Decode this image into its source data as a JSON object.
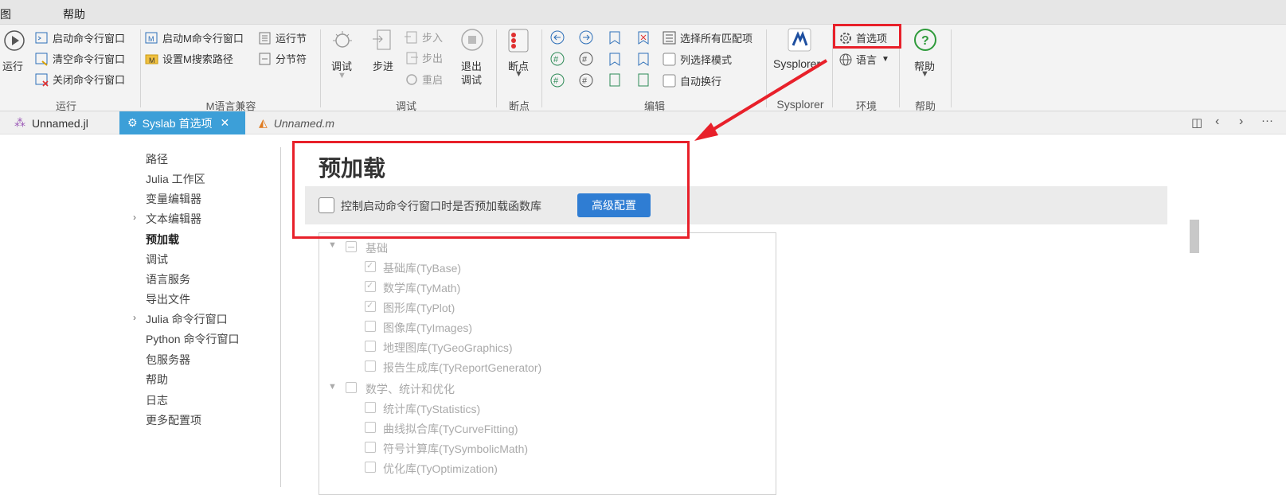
{
  "menu": {
    "left_fragment": "图",
    "help": "帮助"
  },
  "ribbon": {
    "run": {
      "label": "运行",
      "start_cmd": "启动命令行窗口",
      "clear_cmd": "清空命令行窗口",
      "close_cmd": "关闭命令行窗口",
      "group": "运行"
    },
    "mlang": {
      "start_m": "启动M命令行窗口",
      "set_m_path": "设置M搜索路径",
      "run_section": "运行节",
      "section_sep": "分节符",
      "group": "M语言兼容"
    },
    "debug": {
      "debug": "调试",
      "step": "步进",
      "step_in": "步入",
      "step_out": "步出",
      "restart": "重启",
      "exit_debug_1": "退出",
      "exit_debug_2": "调试",
      "group": "调试"
    },
    "breakpoint": {
      "label": "断点",
      "group": "断点"
    },
    "edit": {
      "select_all_matches": "选择所有匹配项",
      "column_select": "列选择模式",
      "word_wrap": "自动换行",
      "group": "编辑"
    },
    "sysplorer": {
      "label": "Sysplorer",
      "group": "Sysplorer"
    },
    "env": {
      "preferences": "首选项",
      "language": "语言",
      "group": "环境"
    },
    "help": {
      "label": "帮助",
      "group": "帮助"
    }
  },
  "tabs": [
    {
      "label": "Unnamed.jl"
    },
    {
      "label": "Syslab 首选项"
    },
    {
      "label": "Unnamed.m"
    }
  ],
  "sidebar": {
    "items": [
      "路径",
      "Julia 工作区",
      "变量编辑器",
      "文本编辑器",
      "预加载",
      "调试",
      "语言服务",
      "导出文件",
      "Julia 命令行窗口",
      "Python 命令行窗口",
      "包服务器",
      "帮助",
      "日志",
      "更多配置项"
    ]
  },
  "main": {
    "title": "预加载",
    "preload_option": "控制启动命令行窗口时是否预加载函数库",
    "advanced_button": "高级配置",
    "tree": {
      "group1": "基础",
      "g1_items": [
        "基础库(TyBase)",
        "数学库(TyMath)",
        "图形库(TyPlot)",
        "图像库(TyImages)",
        "地理图库(TyGeoGraphics)",
        "报告生成库(TyReportGenerator)"
      ],
      "group2": "数学、统计和优化",
      "g2_items": [
        "统计库(TyStatistics)",
        "曲线拟合库(TyCurveFitting)",
        "符号计算库(TySymbolicMath)",
        "优化库(TyOptimization)"
      ]
    }
  },
  "colors": {
    "accent": "#3c9fd8",
    "button": "#2f7dd3",
    "annotation": "#e8202a"
  }
}
